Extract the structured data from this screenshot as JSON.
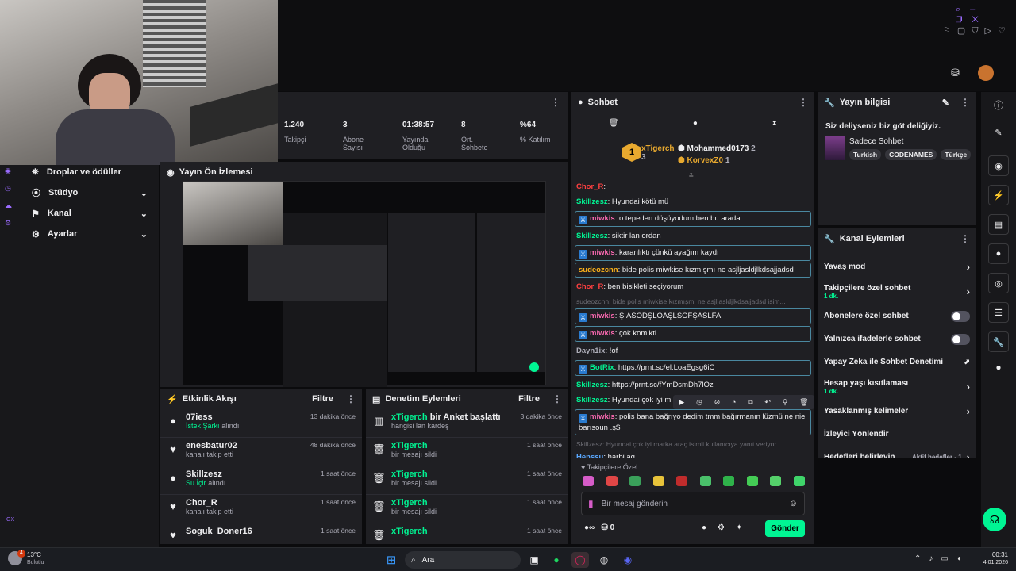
{
  "topbar": {
    "icons": [
      "search-icon",
      "minimize-icon",
      "restore-icon",
      "close-icon"
    ]
  },
  "nav": {
    "items": [
      {
        "label": "Droplar ve ödüller"
      },
      {
        "label": "Stüdyo"
      },
      {
        "label": "Kanal"
      },
      {
        "label": "Ayarlar"
      }
    ]
  },
  "stats": [
    {
      "value": "1.240",
      "label": "Takipçi"
    },
    {
      "value": "3",
      "label": "Abone Sayısı"
    },
    {
      "value": "01:38:57",
      "label": "Yayında Olduğu"
    },
    {
      "value": "8",
      "label": "Ort. Sohbete"
    },
    {
      "value": "%64",
      "label": "% Katılım"
    }
  ],
  "preview": {
    "title": "Yayın Ön İzlemesi"
  },
  "activity": {
    "title": "Etkinlik Akışı",
    "filter": "Filtre",
    "items": [
      {
        "name": "07iess",
        "detail": "İstek Şarkı",
        "detail2": "alındı",
        "time": "13 dakika önce",
        "icon": "●"
      },
      {
        "name": "enesbatur02",
        "detail": "kanalı takip etti",
        "time": "48 dakika önce",
        "icon": "♥"
      },
      {
        "name": "Skillzesz",
        "detail": "Su İçir",
        "detail2": "alındı",
        "time": "1 saat önce",
        "icon": "●"
      },
      {
        "name": "Chor_R",
        "detail": "kanalı takip etti",
        "time": "1 saat önce",
        "icon": "♥"
      },
      {
        "name": "Soguk_Doner16",
        "detail": "",
        "time": "1 saat önce",
        "icon": "♥"
      }
    ]
  },
  "mod": {
    "title": "Denetim Eylemleri",
    "filter": "Filtre",
    "items": [
      {
        "name": "xTigerch",
        "action": "bir Anket başlattı",
        "detail": "hangisi lan kardeş",
        "time": "3 dakika önce"
      },
      {
        "name": "xTigerch",
        "action": "",
        "detail": "bir mesajı sildi",
        "time": "1 saat önce"
      },
      {
        "name": "xTigerch",
        "action": "",
        "detail": "bir mesajı sildi",
        "time": "1 saat önce"
      },
      {
        "name": "xTigerch",
        "action": "",
        "detail": "bir mesajı sildi",
        "time": "1 saat önce"
      },
      {
        "name": "xTigerch",
        "action": "",
        "detail": "",
        "time": "1 saat önce"
      }
    ]
  },
  "chat": {
    "title": "Sohbet",
    "leader1": {
      "name": "xTigerch",
      "count": "3"
    },
    "leader2": {
      "name": "Mohammed0173",
      "count": "2"
    },
    "leader3": {
      "name": "KorvexZ0",
      "count": "1"
    },
    "messages": [
      {
        "user": "Chor_R",
        "text": ":",
        "color": "#ff4040",
        "box": false,
        "mod": false
      },
      {
        "user": "Skillzesz",
        "text": ": Hyundai kötü mü",
        "color": "#00f593",
        "box": false,
        "mod": false
      },
      {
        "user": "miwkis",
        "text": ": o tepeden düşüyodum ben bu arada",
        "color": "#ff6ab3",
        "box": true,
        "mod": true
      },
      {
        "user": "Skillzesz",
        "text": ": siktir lan ordan",
        "color": "#00f593",
        "box": false,
        "mod": false
      },
      {
        "user": "miwkis",
        "text": ": karanlıktı çünkü ayağım kaydı",
        "color": "#ff6ab3",
        "box": true,
        "mod": true
      },
      {
        "user": "sudeozcnn",
        "text": ": bide polis miwkise kızmışmı ne asjljasldjlkdsajjadsd",
        "color": "#ffb31a",
        "box": true,
        "mod": false
      },
      {
        "user": "Chor_R",
        "text": ": ben bisikleti seçiyorum",
        "color": "#ff4040",
        "box": false,
        "mod": false
      },
      {
        "user": "miwkis",
        "text": ": ŞIASÖDŞLÖAŞLSÖFŞASLFA",
        "color": "#ff6ab3",
        "box": true,
        "mod": true,
        "reply": "sudeozcnn: bide polis miwkise kızmışmı ne asjljasldjlkdsajjadsd isim..."
      },
      {
        "user": "miwkis",
        "text": ": çok komikti",
        "color": "#ff6ab3",
        "box": true,
        "mod": true
      },
      {
        "user": "Dayn1ix",
        "text": ": !of",
        "color": "#adadb8",
        "box": false,
        "mod": false
      },
      {
        "user": "BotRix",
        "text": ": https://prnt.sc/el.LoaEgsg6iC",
        "color": "#00f593",
        "box": true,
        "mod": true
      },
      {
        "user": "Skillzesz",
        "text": ": https://prnt.sc/fYmDsmDh7lOz",
        "color": "#00f593",
        "box": false,
        "mod": false
      },
      {
        "user": "Skillzesz",
        "text": ": Hyundai çok iyi m",
        "color": "#00f593",
        "box": false,
        "mod": false
      },
      {
        "user": "miwkis",
        "text": ": polis bana bağrıyo dedim tmm bağırmanın lüzmü ne nie barısoun .ş$",
        "color": "#ff6ab3",
        "box": true,
        "mod": true
      },
      {
        "user": "Henssu",
        "text": ": harbi aq",
        "color": "#5aa8ff",
        "box": false,
        "mod": false,
        "reply": "Skillzesz: Hyundai çok iyi marka araç isimli kullanıcıya yanıt veriyor"
      }
    ],
    "emote_label": "Takipçilere Özel",
    "placeholder": "Bir mesaj gönderin",
    "points": "0",
    "send": "Gönder"
  },
  "info": {
    "title": "Yayın bilgisi",
    "stream_title": "Siz deliyseniz biz göt deliğiyiz.",
    "category": "Sadece Sohbet",
    "tags": [
      "Turkish",
      "CODENAMES",
      "Türkçe"
    ]
  },
  "actions": {
    "title": "Kanal Eylemleri",
    "items": [
      {
        "label": "Yavaş mod",
        "sub": "",
        "kind": "arrow"
      },
      {
        "label": "Takipçilere özel sohbet",
        "sub": "1 dk.",
        "kind": "arrow"
      },
      {
        "label": "Abonelere özel sohbet",
        "sub": "",
        "kind": "toggle"
      },
      {
        "label": "Yalnızca ifadelerle sohbet",
        "sub": "",
        "kind": "toggle"
      },
      {
        "label": "Yapay Zeka ile Sohbet Denetimi",
        "sub": "",
        "kind": "ext"
      },
      {
        "label": "Hesap yaşı kısıtlaması",
        "sub": "1 dk.",
        "kind": "arrow"
      },
      {
        "label": "Yasaklanmış kelimeler",
        "sub": "",
        "kind": "arrow"
      },
      {
        "label": "İzleyici Yönlendir",
        "sub": "",
        "kind": "none"
      },
      {
        "label": "Hedefleri belirleyin",
        "sub": "",
        "kind": "arrow",
        "badge": "Aktif hedefler - 1"
      }
    ]
  },
  "taskbar": {
    "temp": "13°C",
    "weather": "Bulutlu",
    "search": "Ara",
    "time": "00:31",
    "date": "4.01.2026",
    "badge": "4"
  },
  "sidebar_gx": "GX"
}
